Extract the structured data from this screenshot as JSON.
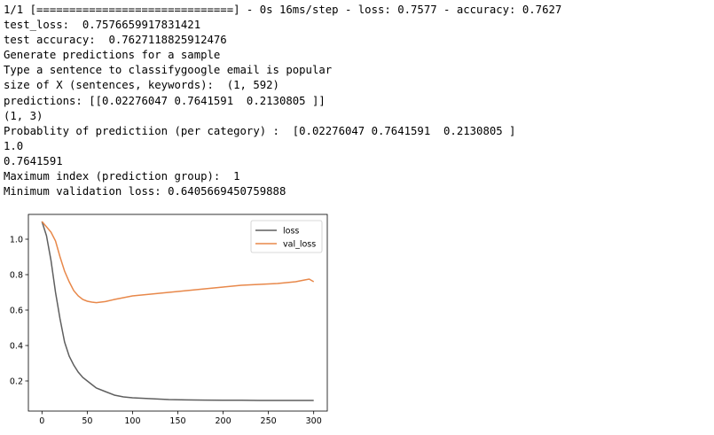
{
  "console": {
    "lines": [
      "1/1 [==============================] - 0s 16ms/step - loss: 0.7577 - accuracy: 0.7627",
      "test_loss:  0.7576659917831421",
      "test accuracy:  0.7627118825912476",
      "Generate predictions for a sample",
      "Type a sentence to classifygoogle email is popular",
      "size of X (sentences, keywords):  (1, 592)",
      "predictions: [[0.02276047 0.7641591  0.2130805 ]]",
      "(1, 3)",
      "Probablity of predictiion (per category) :  [0.02276047 0.7641591  0.2130805 ]",
      "1.0",
      "0.7641591",
      "Maximum index (prediction group):  1",
      "Minimum validation loss: 0.6405669450759888"
    ]
  },
  "chart_data": {
    "type": "line",
    "title": "",
    "xlabel": "",
    "ylabel": "",
    "xlim": [
      -15,
      315
    ],
    "ylim": [
      0.03,
      1.14
    ],
    "xticks": [
      "0",
      "50",
      "100",
      "150",
      "200",
      "250",
      "300"
    ],
    "yticks": [
      "0.2",
      "0.4",
      "0.6",
      "0.8",
      "1.0"
    ],
    "grid": false,
    "legend_position": "upper right",
    "x": [
      0,
      5,
      10,
      15,
      20,
      25,
      30,
      35,
      40,
      45,
      50,
      55,
      60,
      70,
      80,
      90,
      100,
      120,
      140,
      160,
      180,
      200,
      220,
      240,
      260,
      280,
      290,
      295,
      300
    ],
    "series": [
      {
        "name": "loss",
        "color": "#5f5f5f",
        "values": [
          1.1,
          1.02,
          0.88,
          0.7,
          0.55,
          0.42,
          0.34,
          0.29,
          0.25,
          0.22,
          0.2,
          0.18,
          0.16,
          0.14,
          0.12,
          0.11,
          0.105,
          0.1,
          0.095,
          0.093,
          0.092,
          0.091,
          0.091,
          0.09,
          0.09,
          0.09,
          0.09,
          0.09,
          0.09
        ]
      },
      {
        "name": "val_loss",
        "color": "#e8884a",
        "values": [
          1.1,
          1.07,
          1.04,
          0.99,
          0.9,
          0.82,
          0.76,
          0.71,
          0.68,
          0.66,
          0.65,
          0.645,
          0.642,
          0.648,
          0.66,
          0.67,
          0.68,
          0.69,
          0.7,
          0.71,
          0.72,
          0.73,
          0.74,
          0.745,
          0.75,
          0.76,
          0.77,
          0.775,
          0.76
        ]
      }
    ]
  }
}
